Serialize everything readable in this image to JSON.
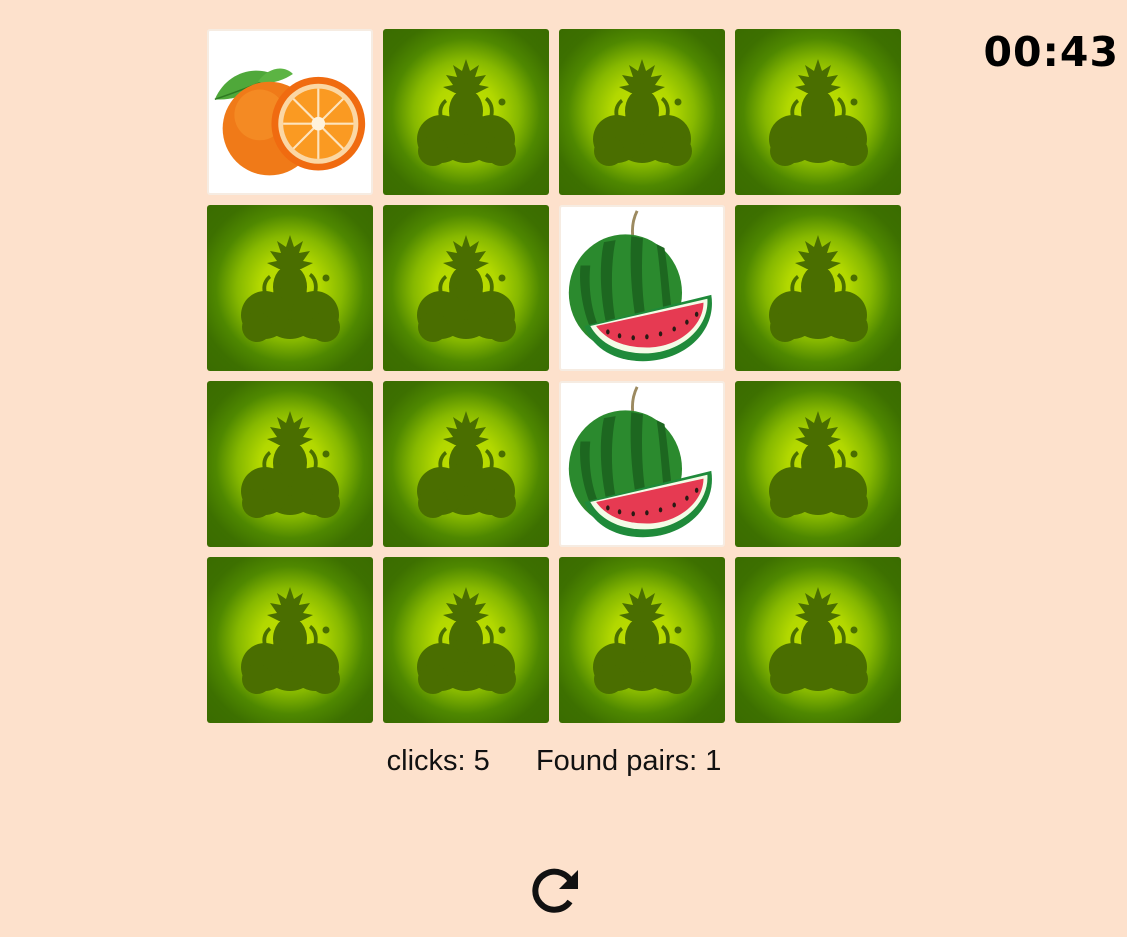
{
  "timer": "00:43",
  "stats": {
    "clicks_label": "clicks:",
    "clicks": "5",
    "pairs_label": "Found pairs:",
    "pairs": "1"
  },
  "cards": [
    {
      "state": "face-up",
      "fruit": "orange"
    },
    {
      "state": "face-down",
      "fruit": null
    },
    {
      "state": "face-down",
      "fruit": null
    },
    {
      "state": "face-down",
      "fruit": null
    },
    {
      "state": "face-down",
      "fruit": null
    },
    {
      "state": "face-down",
      "fruit": null
    },
    {
      "state": "face-up",
      "fruit": "watermelon"
    },
    {
      "state": "face-down",
      "fruit": null
    },
    {
      "state": "face-down",
      "fruit": null
    },
    {
      "state": "face-down",
      "fruit": null
    },
    {
      "state": "face-up",
      "fruit": "watermelon"
    },
    {
      "state": "face-down",
      "fruit": null
    },
    {
      "state": "face-down",
      "fruit": null
    },
    {
      "state": "face-down",
      "fruit": null
    },
    {
      "state": "face-down",
      "fruit": null
    },
    {
      "state": "face-down",
      "fruit": null
    }
  ],
  "icons": {
    "card_back": "fruit-silhouette-icon",
    "restart": "restart-icon"
  },
  "colors": {
    "background": "#fde1cc",
    "card_back_center": "#c4e000",
    "card_back_edge": "#3a6c00",
    "silhouette": "#4a6e00"
  }
}
